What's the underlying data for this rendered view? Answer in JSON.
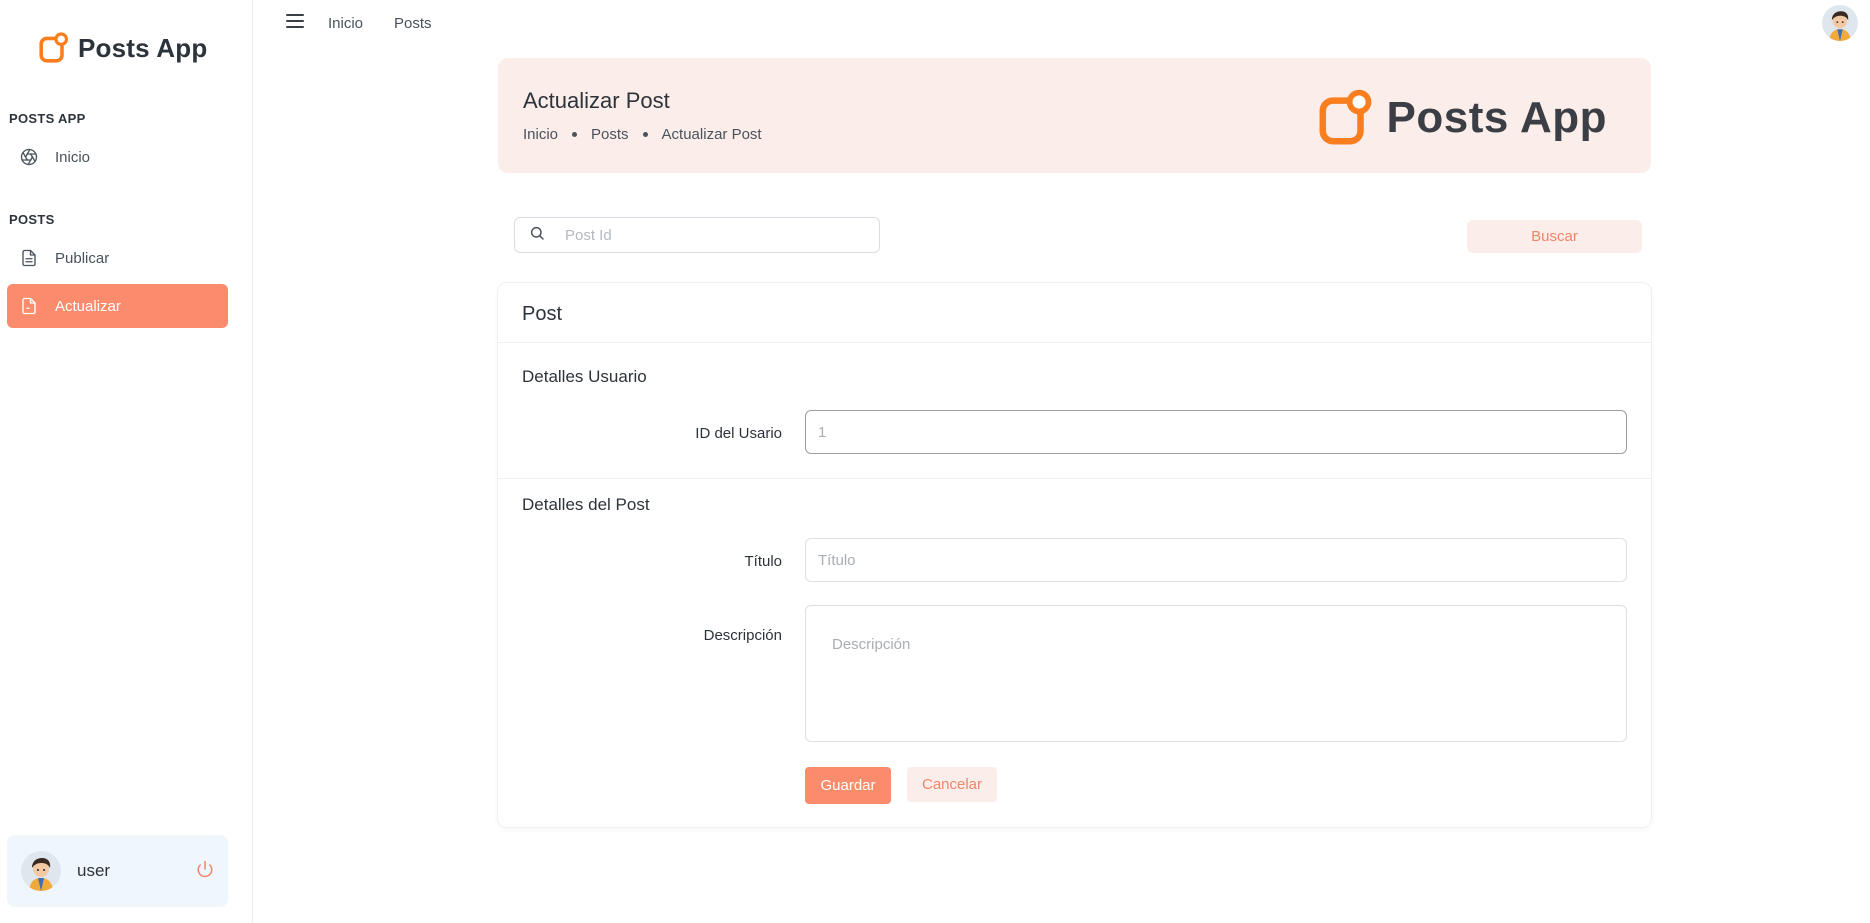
{
  "app": {
    "name": "Posts App",
    "brand_color": "#fb8b6d",
    "logo_color": "#f97e1f"
  },
  "sidebar": {
    "sections": [
      {
        "label": "POSTS APP",
        "items": [
          {
            "label": "Inicio",
            "icon": "aperture-icon"
          }
        ]
      },
      {
        "label": "POSTS",
        "items": [
          {
            "label": "Publicar",
            "icon": "file-text-icon"
          },
          {
            "label": "Actualizar",
            "icon": "file-edit-icon",
            "active": true
          }
        ]
      }
    ],
    "user": {
      "name": "user",
      "icon": "power-icon"
    }
  },
  "topbar": {
    "links": [
      "Inicio",
      "Posts"
    ],
    "menu_icon": "hamburger-icon"
  },
  "header": {
    "title": "Actualizar Post",
    "breadcrumbs": [
      "Inicio",
      "Posts",
      "Actualizar Post"
    ],
    "brand_text": "Posts App"
  },
  "search": {
    "placeholder": "Post Id",
    "value": "",
    "button_label": "Buscar"
  },
  "form": {
    "card_title": "Post",
    "user_section": {
      "title": "Detalles Usuario",
      "user_id_label": "ID del Usario",
      "user_id_placeholder": "1"
    },
    "post_section": {
      "title": "Detalles del Post",
      "title_label": "Título",
      "title_placeholder": "Título",
      "description_label": "Descripción",
      "description_placeholder": "Descripción"
    },
    "save_label": "Guardar",
    "cancel_label": "Cancelar"
  }
}
